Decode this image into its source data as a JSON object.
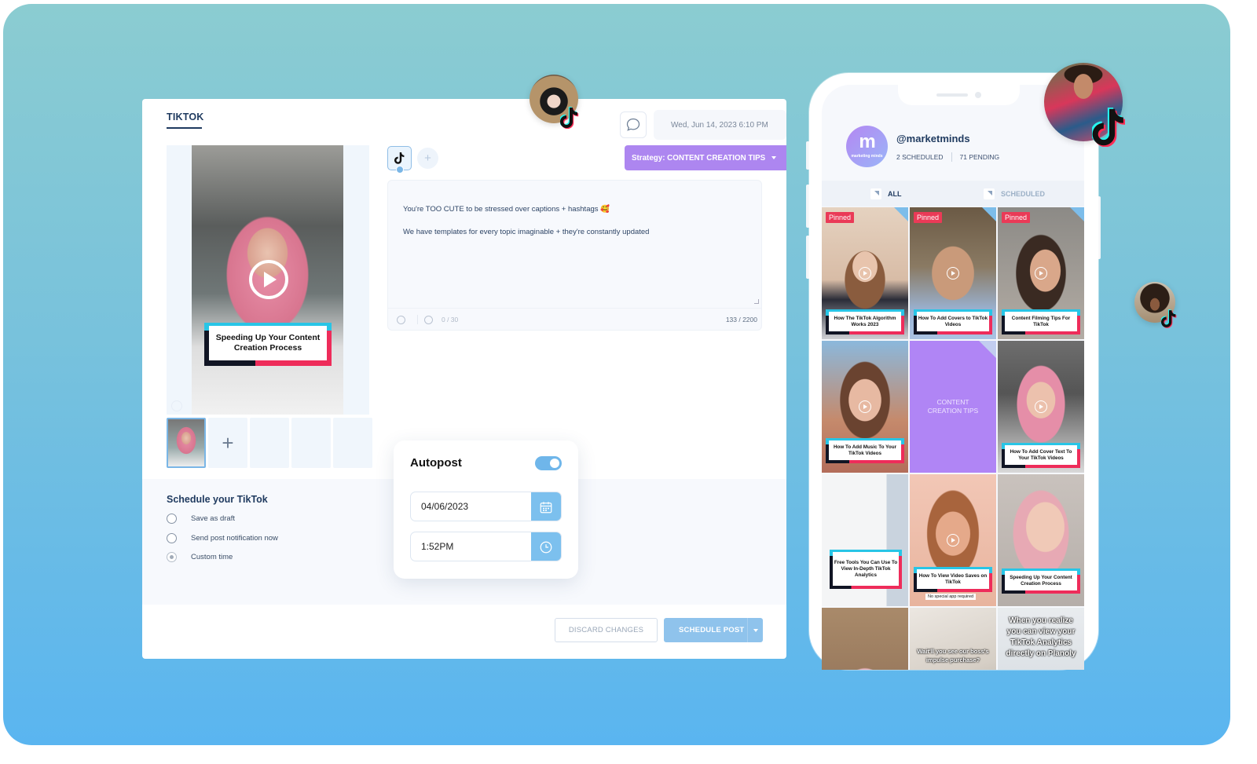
{
  "colors": {
    "accent_blue": "#7cc0ee",
    "strategy_purple": "#ad86f0",
    "navy_text": "#1f3a5f",
    "pinned_red": "#ea3a57",
    "tiktok_cyan": "#28c5e6",
    "tiktok_pink": "#ee2c5a"
  },
  "editor": {
    "tab_label": "TIKTOK",
    "date_display": "Wed, Jun 14, 2023 6:10 PM",
    "strategy_label": "Strategy: CONTENT CREATION TIPS",
    "network_icon": "tiktok-icon",
    "media": {
      "cover_text": "Speeding Up Your Content Creation Process",
      "add_icon": "+"
    },
    "caption": {
      "line1": "You're TOO CUTE to be stressed over captions + hashtags 🥰",
      "line2": "We have templates for every topic imaginable + they're constantly updated",
      "hashtag_count": "0 / 30",
      "char_count": "133 / 2200"
    },
    "schedule": {
      "title": "Schedule your TikTok",
      "options": [
        {
          "label": "Save as draft",
          "selected": false
        },
        {
          "label": "Send post notification now",
          "selected": false
        },
        {
          "label": "Custom time",
          "selected": true
        }
      ]
    },
    "buttons": {
      "discard": "DISCARD CHANGES",
      "schedule": "SCHEDULE POST"
    }
  },
  "autopost": {
    "title": "Autopost",
    "enabled": true,
    "date_value": "04/06/2023",
    "time_value": "1:52PM"
  },
  "phone": {
    "brand_logo_text": "m",
    "brand_logo_sub": "marketing minds",
    "handle": "@marketminds",
    "scheduled": "2 SCHEDULED",
    "pending": "71 PENDING",
    "tabs": [
      {
        "label": "ALL",
        "active": true
      },
      {
        "label": "SCHEDULED",
        "active": false
      }
    ],
    "pinned_label": "Pinned",
    "tiles": [
      {
        "title": "How The TikTok Algorithm Works 2023",
        "pinned": true
      },
      {
        "title": "How To Add Covers to TikTok Videos",
        "pinned": true
      },
      {
        "title": "Content Filming Tips For TikTok",
        "pinned": true
      },
      {
        "title": "How To Add Music To Your TikTok Videos",
        "pinned": false
      },
      {
        "title": "CONTENT CREATION TIPS",
        "pinned": false,
        "placeholder": true
      },
      {
        "title": "How To Add Cover Text To Your TikTok Videos",
        "pinned": false
      },
      {
        "title": "Free Tools You Can Use To View In-Depth TikTok Analytics",
        "pinned": false
      },
      {
        "title": "How To View Video Saves on TikTok",
        "pinned": false,
        "subcaption": "No special app required"
      },
      {
        "title": "Speeding Up Your Content Creation Process",
        "pinned": false
      },
      {
        "title": "",
        "pinned": false
      },
      {
        "title": "Wait'll you see our boss's impulse purchase?",
        "pinned": false
      },
      {
        "title": "When you realize you can view your TikTok Analytics directly on Planoly",
        "pinned": false
      }
    ]
  }
}
